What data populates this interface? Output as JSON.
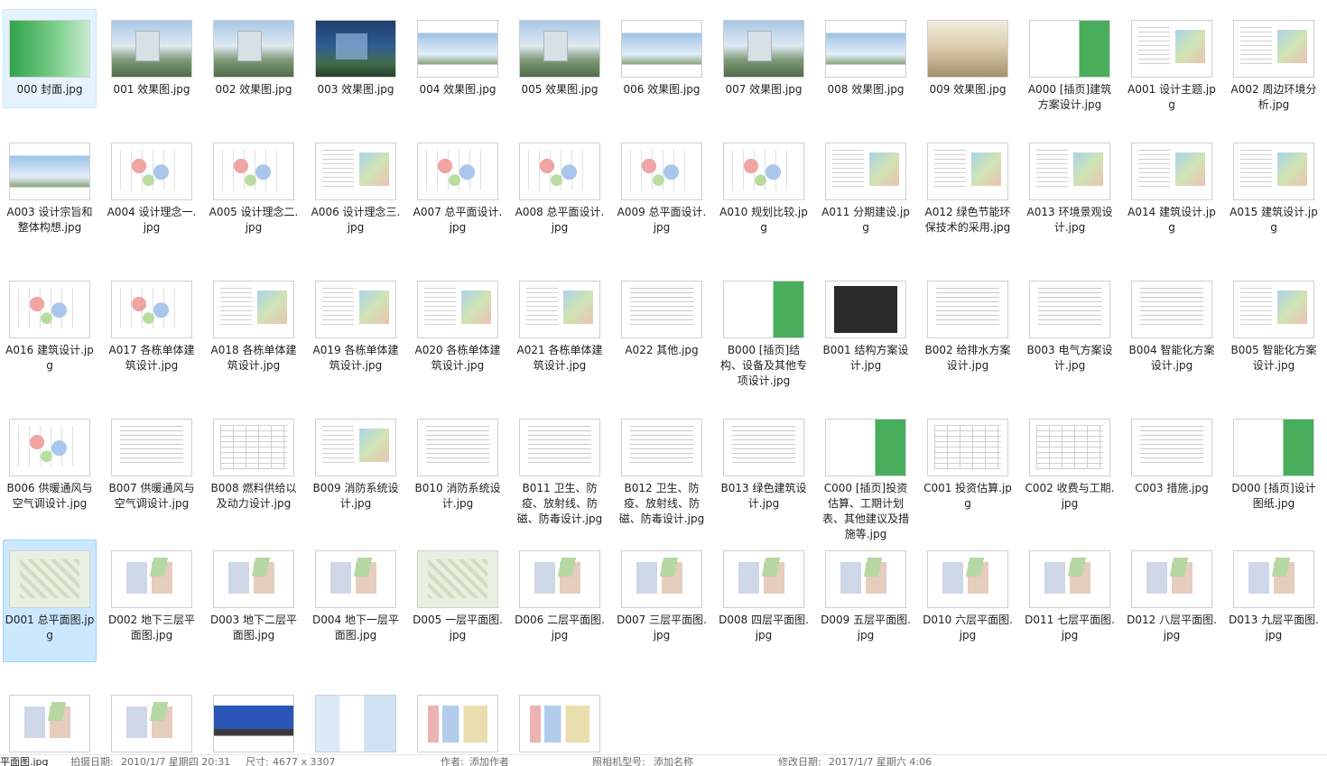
{
  "files": [
    {
      "name": "000 封面.jpg",
      "thumb": "cover",
      "state": "focus"
    },
    {
      "name": "001 效果图.jpg",
      "thumb": "photo"
    },
    {
      "name": "002 效果图.jpg",
      "thumb": "photo"
    },
    {
      "name": "003 效果图.jpg",
      "thumb": "photo-dark"
    },
    {
      "name": "004 效果图.jpg",
      "thumb": "photo-wide"
    },
    {
      "name": "005 效果图.jpg",
      "thumb": "photo"
    },
    {
      "name": "006 效果图.jpg",
      "thumb": "photo-wide"
    },
    {
      "name": "007 效果图.jpg",
      "thumb": "photo"
    },
    {
      "name": "008 效果图.jpg",
      "thumb": "photo-wide"
    },
    {
      "name": "009 效果图.jpg",
      "thumb": "interior"
    },
    {
      "name": "A000 [插页]建筑方案设计.jpg",
      "thumb": "green-page"
    },
    {
      "name": "A001 设计主题.jpg",
      "thumb": "layout"
    },
    {
      "name": "A002 周边环境分析.jpg",
      "thumb": "layout"
    },
    {
      "name": "A003 设计宗旨和整体构想.jpg",
      "thumb": "photo-wide"
    },
    {
      "name": "A004 设计理念一.jpg",
      "thumb": "diagram"
    },
    {
      "name": "A005 设计理念二.jpg",
      "thumb": "diagram"
    },
    {
      "name": "A006 设计理念三.jpg",
      "thumb": "layout"
    },
    {
      "name": "A007 总平面设计.jpg",
      "thumb": "diagram"
    },
    {
      "name": "A008 总平面设计.jpg",
      "thumb": "diagram"
    },
    {
      "name": "A009 总平面设计.jpg",
      "thumb": "diagram"
    },
    {
      "name": "A010 规划比较.jpg",
      "thumb": "diagram"
    },
    {
      "name": "A011 分期建设.jpg",
      "thumb": "layout"
    },
    {
      "name": "A012 绿色节能环保技术的采用.jpg",
      "thumb": "layout"
    },
    {
      "name": "A013 环境景观设计.jpg",
      "thumb": "layout"
    },
    {
      "name": "A014 建筑设计.jpg",
      "thumb": "layout"
    },
    {
      "name": "A015 建筑设计.jpg",
      "thumb": "layout"
    },
    {
      "name": "A016 建筑设计.jpg",
      "thumb": "diagram"
    },
    {
      "name": "A017 各栋单体建筑设计.jpg",
      "thumb": "diagram"
    },
    {
      "name": "A018 各栋单体建筑设计.jpg",
      "thumb": "layout"
    },
    {
      "name": "A019 各栋单体建筑设计.jpg",
      "thumb": "layout"
    },
    {
      "name": "A020 各栋单体建筑设计.jpg",
      "thumb": "layout"
    },
    {
      "name": "A021 各栋单体建筑设计.jpg",
      "thumb": "layout"
    },
    {
      "name": "A022 其他.jpg",
      "thumb": "doc"
    },
    {
      "name": "B000 [插页]结构、设备及其他专项设计.jpg",
      "thumb": "green-page"
    },
    {
      "name": "B001 结构方案设计.jpg",
      "thumb": "black"
    },
    {
      "name": "B002 给排水方案设计.jpg",
      "thumb": "doc"
    },
    {
      "name": "B003 电气方案设计.jpg",
      "thumb": "doc"
    },
    {
      "name": "B004 智能化方案设计.jpg",
      "thumb": "doc"
    },
    {
      "name": "B005 智能化方案设计.jpg",
      "thumb": "layout"
    },
    {
      "name": "B006 供暖通风与空气调设计.jpg",
      "thumb": "diagram"
    },
    {
      "name": "B007 供暖通风与空气调设计.jpg",
      "thumb": "doc"
    },
    {
      "name": "B008 燃料供给以及动力设计.jpg",
      "thumb": "table"
    },
    {
      "name": "B009 消防系统设计.jpg",
      "thumb": "layout"
    },
    {
      "name": "B010 消防系统设计.jpg",
      "thumb": "doc"
    },
    {
      "name": "B011 卫生、防疫、放射线、防磁、防毒设计.jpg",
      "thumb": "doc"
    },
    {
      "name": "B012 卫生、防疫、放射线、防磁、防毒设计.jpg",
      "thumb": "doc"
    },
    {
      "name": "B013 绿色建筑设计.jpg",
      "thumb": "doc"
    },
    {
      "name": "C000 [插页]投资估算、工期计划表、其他建议及措施等.jpg",
      "thumb": "green-page"
    },
    {
      "name": "C001 投资估算.jpg",
      "thumb": "table"
    },
    {
      "name": "C002 收费与工期.jpg",
      "thumb": "table"
    },
    {
      "name": "C003 措施.jpg",
      "thumb": "doc"
    },
    {
      "name": "D000 [插页]设计图纸.jpg",
      "thumb": "green-page"
    },
    {
      "name": "D001 总平面图.jpg",
      "thumb": "siteplan",
      "state": "selected"
    },
    {
      "name": "D002 地下三层平面图.jpg",
      "thumb": "plan"
    },
    {
      "name": "D003 地下二层平面图.jpg",
      "thumb": "plan"
    },
    {
      "name": "D004 地下一层平面图.jpg",
      "thumb": "plan"
    },
    {
      "name": "D005 一层平面图.jpg",
      "thumb": "siteplan"
    },
    {
      "name": "D006 二层平面图.jpg",
      "thumb": "plan"
    },
    {
      "name": "D007 三层平面图.jpg",
      "thumb": "plan"
    },
    {
      "name": "D008 四层平面图.jpg",
      "thumb": "plan"
    },
    {
      "name": "D009 五层平面图.jpg",
      "thumb": "plan"
    },
    {
      "name": "D010 六层平面图.jpg",
      "thumb": "plan"
    },
    {
      "name": "D011 七层平面图.jpg",
      "thumb": "plan"
    },
    {
      "name": "D012 八层平面图.jpg",
      "thumb": "plan"
    },
    {
      "name": "D013 九层平面图.jpg",
      "thumb": "plan"
    },
    {
      "name": "",
      "thumb": "plan"
    },
    {
      "name": "",
      "thumb": "plan"
    },
    {
      "name": "",
      "thumb": "elev"
    },
    {
      "name": "",
      "thumb": "split"
    },
    {
      "name": "",
      "thumb": "section"
    },
    {
      "name": "",
      "thumb": "section"
    }
  ],
  "status_bar": {
    "filename": "平面图.jpg",
    "date_taken_label": "拍摄日期:",
    "date_taken": "2010/1/7 星期四 20:31",
    "size_label": "尺寸:",
    "size": "4677 x 3307",
    "author_label": "作者:",
    "author": "添加作者",
    "camera_label": "照相机型号:",
    "camera": "添加名称",
    "modified_label": "修改日期:",
    "modified": "2017/1/7 星期六 4:06"
  }
}
